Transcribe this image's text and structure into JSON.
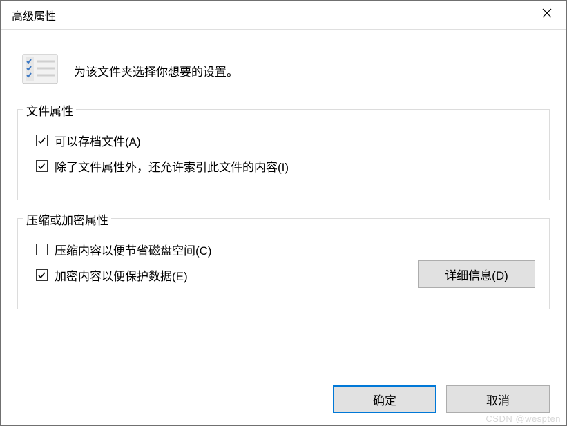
{
  "title": "高级属性",
  "intro": "为该文件夹选择你想要的设置。",
  "group1": {
    "legend": "文件属性",
    "archive": {
      "label": "可以存档文件(A)",
      "checked": true
    },
    "index": {
      "label": "除了文件属性外，还允许索引此文件的内容(I)",
      "checked": true
    }
  },
  "group2": {
    "legend": "压缩或加密属性",
    "compress": {
      "label": "压缩内容以便节省磁盘空间(C)",
      "checked": false
    },
    "encrypt": {
      "label": "加密内容以便保护数据(E)",
      "checked": true
    },
    "details_btn": "详细信息(D)"
  },
  "buttons": {
    "ok": "确定",
    "cancel": "取消"
  },
  "watermark": "CSDN @wespten"
}
